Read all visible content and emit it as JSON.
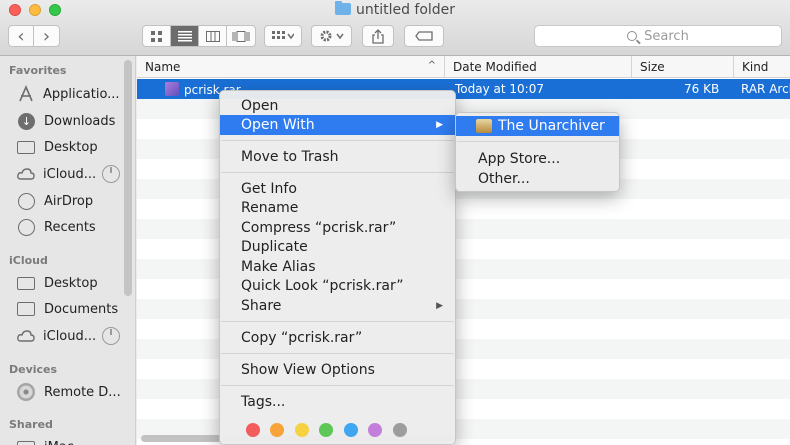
{
  "window": {
    "title": "untitled folder",
    "colors": {
      "close": "#fc605b",
      "minimize": "#fdbc40",
      "maximize": "#34c84a"
    }
  },
  "toolbar": {
    "back_glyph": "‹",
    "forward_glyph": "›",
    "view_icons": [
      "icon-view-icon",
      "list-view-icon",
      "column-view-icon",
      "cover-flow-icon"
    ],
    "active_view": "list-view-icon",
    "search_placeholder": "Search"
  },
  "sidebar": {
    "sections": [
      {
        "title": "Favorites",
        "items": [
          "Applicatio...",
          "Downloads",
          "Desktop",
          "iCloud...",
          "AirDrop",
          "Recents"
        ]
      },
      {
        "title": "iCloud",
        "items": [
          "Desktop",
          "Documents",
          "iCloud..."
        ]
      },
      {
        "title": "Devices",
        "items": [
          "Remote D..."
        ]
      },
      {
        "title": "Shared",
        "items": [
          "iMac"
        ]
      }
    ]
  },
  "list": {
    "columns": [
      "Name",
      "Date Modified",
      "Size",
      "Kind"
    ],
    "sort_indicator": "^",
    "selected_row": {
      "name": "pcrisk.rar",
      "date": "Today at 10:07",
      "size": "76 KB",
      "kind": "RAR Archive"
    }
  },
  "context_menu": {
    "items": [
      "Open",
      "Open With",
      "Move to Trash",
      "Get Info",
      "Rename",
      "Compress “pcrisk.rar”",
      "Duplicate",
      "Make Alias",
      "Quick Look “pcrisk.rar”",
      "Share",
      "Copy “pcrisk.rar”",
      "Show View Options",
      "Tags..."
    ],
    "highlighted": "Open With",
    "submenu_arrow": "▶",
    "tag_colors": [
      "#f25c5c",
      "#f7a33a",
      "#f6d142",
      "#5fc758",
      "#3fa6f1",
      "#c37fdb",
      "#9d9d9d"
    ]
  },
  "open_with_submenu": {
    "items": [
      "The Unarchiver",
      "App Store...",
      "Other..."
    ],
    "highlighted": "The Unarchiver"
  },
  "accent_color": "#2f7cf1"
}
